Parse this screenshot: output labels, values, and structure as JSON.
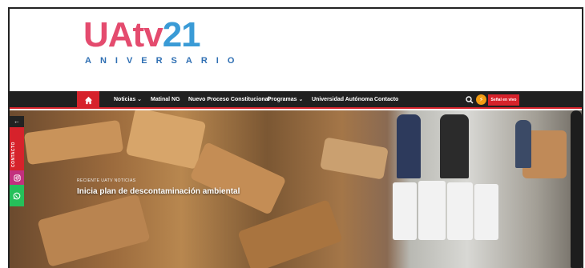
{
  "logo": {
    "main": "UAtv",
    "number": "21",
    "sub": "ANIVERSARIO"
  },
  "nav": {
    "home_icon": "home-icon",
    "items": [
      {
        "label": "Noticias ⌄"
      },
      {
        "label": "Matinal NG"
      },
      {
        "label": "Nuevo Proceso Constitucional"
      },
      {
        "label": "Programas ⌄"
      },
      {
        "label": "Universidad Autónoma"
      },
      {
        "label": "Contacto"
      }
    ],
    "search_icon": "search-icon",
    "bolt_icon": "bolt-icon",
    "live_label": "Señal en vivo"
  },
  "hero": {
    "tags": "RECIENTE   UATV NOTICIAS",
    "title": "Inicia plan de descontaminación ambiental"
  },
  "sidebar": {
    "toggle": "←",
    "contact_label": "CONTACTO",
    "instagram_icon": "instagram-icon",
    "whatsapp_icon": "whatsapp-icon"
  },
  "colors": {
    "accent": "#d6222b",
    "nav_bg": "#202020",
    "logo_pink": "#e44b6e",
    "logo_blue": "#3a9bd6"
  }
}
